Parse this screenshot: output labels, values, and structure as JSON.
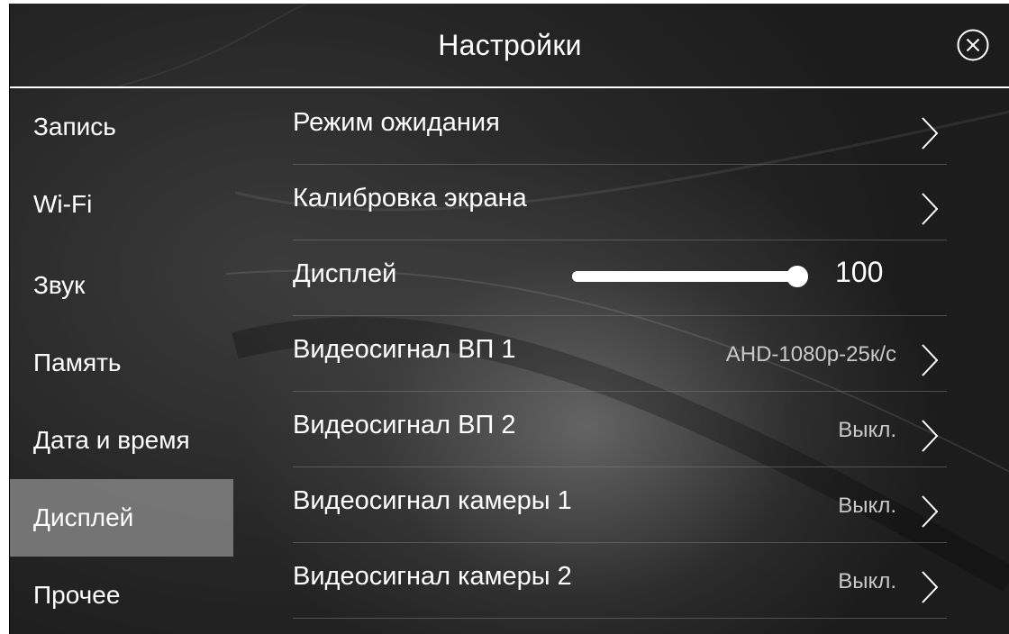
{
  "header": {
    "title": "Настройки",
    "close_icon": "close-circle-icon"
  },
  "sidebar": {
    "items": [
      {
        "label": "Запись",
        "active": false
      },
      {
        "label": "Wi-Fi",
        "active": false
      },
      {
        "label": "Звук",
        "active": false
      },
      {
        "label": "Память",
        "active": false
      },
      {
        "label": "Дата и время",
        "active": false
      },
      {
        "label": "Дисплей",
        "active": true
      },
      {
        "label": "Прочее",
        "active": false
      }
    ]
  },
  "main": {
    "rows": [
      {
        "label": "Режим ожидания",
        "value": "",
        "icon": "chevron-right-icon"
      },
      {
        "label": "Калибровка экрана",
        "value": "",
        "icon": "chevron-right-icon"
      },
      {
        "label": "Дисплей",
        "slider_value": "100",
        "slider_fraction": 1.0
      },
      {
        "label": "Видеосигнал ВП 1",
        "value": "AHD-1080p-25к/с",
        "icon": "chevron-right-icon"
      },
      {
        "label": "Видеосигнал ВП 2",
        "value": "Выкл.",
        "icon": "chevron-right-icon"
      },
      {
        "label": "Видеосигнал камеры 1",
        "value": "Выкл.",
        "icon": "chevron-right-icon"
      },
      {
        "label": "Видеосигнал камеры 2",
        "value": "Выкл.",
        "icon": "chevron-right-icon"
      }
    ]
  },
  "colors": {
    "active_item": "#828282",
    "text": "#ffffff",
    "value_text": "#c9c9c9"
  }
}
